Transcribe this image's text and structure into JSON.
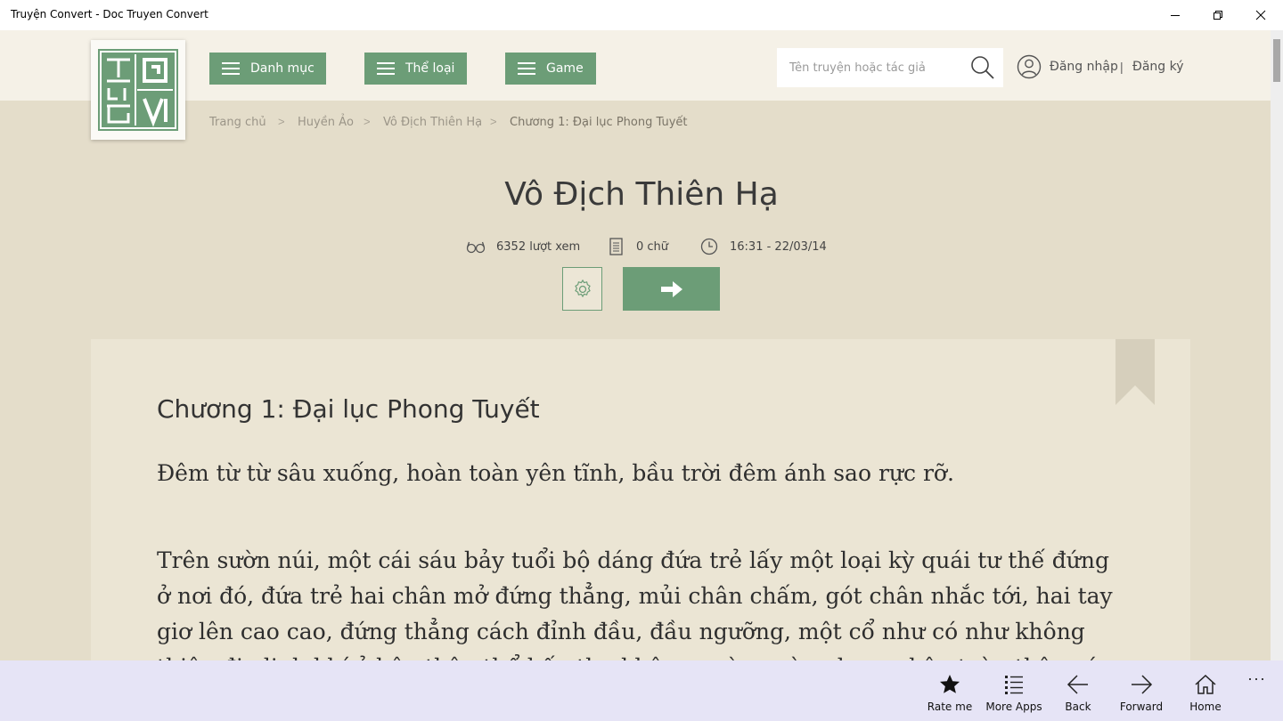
{
  "window": {
    "title": "Truyện Convert - Doc Truyen Convert"
  },
  "header": {
    "nav": [
      {
        "label": "Danh mục"
      },
      {
        "label": "Thể loại"
      },
      {
        "label": "Game"
      }
    ],
    "search_placeholder": "Tên truyện hoặc tác giả",
    "login_label": "Đăng nhập",
    "separator": "|",
    "register_label": "Đăng ký"
  },
  "breadcrumb": {
    "items": [
      "Trang chủ",
      "Huyền Ảo",
      "Vô Địch Thiên Hạ",
      "Chương 1: Đại lục Phong Tuyết"
    ],
    "separator": ">"
  },
  "book": {
    "title": "Vô Địch Thiên Hạ",
    "views": "6352 lượt xem",
    "words": "0 chữ",
    "updated": "16:31 - 22/03/14"
  },
  "chapter": {
    "title": "Chương 1: Đại lục Phong Tuyết",
    "paragraphs": [
      "Đêm từ từ sâu xuống, hoàn toàn yên tĩnh, bầu trời đêm ánh sao rực rỡ.",
      "Trên sườn núi, một cái sáu bảy tuổi bộ dáng đứa trẻ lấy một loại kỳ quái tư thế đứng ở nơi đó, đứa trẻ hai chân mở đứng thẳng, mủi chân chấm, gót chân nhắc tới, hai tay giơ lên cao cao, đứng thẳng cách đỉnh đầu, đầu ngưỡng, một cổ như có như không thiên địa linh khí ở bên thân thể hấp thu không ngừng vào, dung nhập toàn thân các chỗ."
    ]
  },
  "appbar": {
    "buttons": [
      {
        "label": "Rate me",
        "icon": "star-icon"
      },
      {
        "label": "More Apps",
        "icon": "list-icon"
      },
      {
        "label": "Back",
        "icon": "arrow-left-icon"
      },
      {
        "label": "Forward",
        "icon": "arrow-right-icon"
      },
      {
        "label": "Home",
        "icon": "home-icon"
      }
    ],
    "more": "···"
  },
  "colors": {
    "accent": "#6c9d77",
    "background": "#e4ddca",
    "header": "#f5f1e7",
    "panel": "#ebe5d4",
    "appbar": "#e6e4f6"
  }
}
